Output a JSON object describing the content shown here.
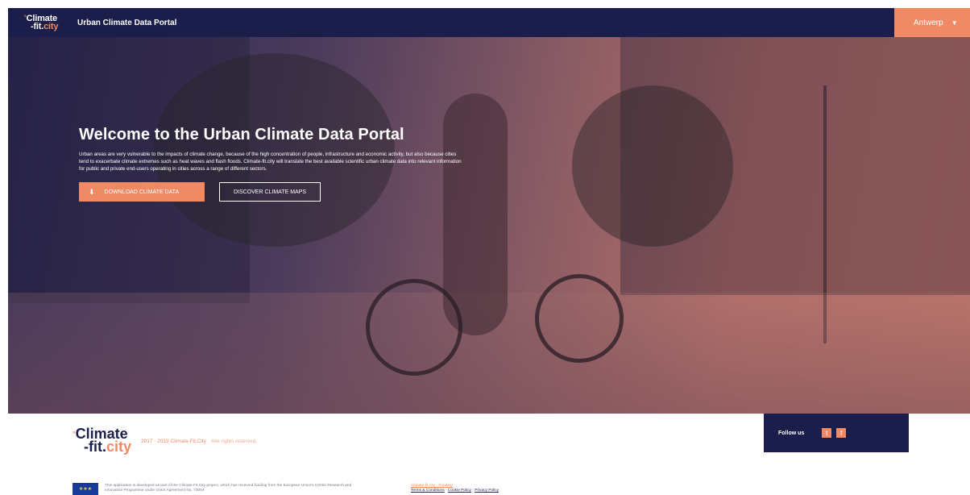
{
  "header": {
    "logo_line1": "Climate",
    "logo_line2_prefix": "-fit.",
    "logo_line2_accent": "city",
    "portal_title": "Urban Climate Data Portal",
    "city_selected": "Antwerp"
  },
  "hero": {
    "title": "Welcome to the Urban Climate Data Portal",
    "description": "Urban areas are very vulnerable to the impacts of climate change, because of the high concentration of people, infrastructure and economic activity, but also because cities tend to exacerbate climate extremes such as heat waves and flash floods. Climate-fit.city will translate the best available scientific urban climate data into relevant information for public and private end-users operating in cities across a range of different sectors.",
    "download_label": "DOWNLOAD CLIMATE DATA",
    "discover_label": "DISCOVER CLIMATE MAPS"
  },
  "footer": {
    "logo_line1": "Climate",
    "logo_line2_prefix": "-fit.",
    "logo_line2_accent": "city",
    "copyright": "2017 - 2019 Climate-Fit.City",
    "rights": "Alle rights reserved.",
    "follow_label": "Follow us",
    "social": {
      "twitter_glyph": "t",
      "facebook_glyph": "f"
    },
    "funding_text": "This application is developed as part of the Climate-Fit.City project, which has received funding from the European Union's H2020 Research and Innovation Programme under Grant Agreement No. 73004",
    "links": {
      "funding": "Climate-fit.city - Funding",
      "terms": "Terms & Conditions",
      "cookie": "Cookie Policy",
      "privacy": "Privacy Policy",
      "separator": " - "
    }
  },
  "colors": {
    "navy": "#1b1e4b",
    "accent": "#f08a64"
  }
}
